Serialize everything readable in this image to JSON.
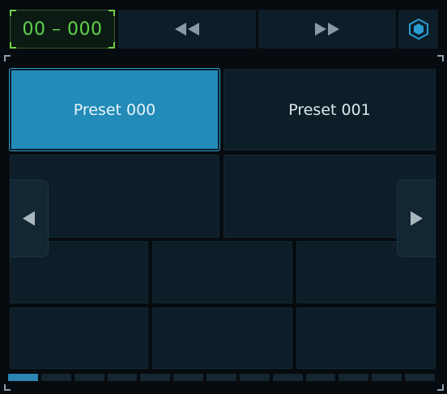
{
  "toolbar": {
    "counter": "00 – 000",
    "rewind_icon": "double-left-triangle",
    "forward_icon": "double-right-triangle",
    "menu_icon": "hexagon-icon"
  },
  "presets": [
    {
      "label": "Preset 000",
      "active": true
    },
    {
      "label": "Preset 001",
      "active": false
    },
    {
      "label": "",
      "active": false
    },
    {
      "label": "",
      "active": false
    },
    {
      "label": "",
      "active": false
    },
    {
      "label": "",
      "active": false
    },
    {
      "label": "",
      "active": false
    },
    {
      "label": "",
      "active": false
    },
    {
      "label": "",
      "active": false
    },
    {
      "label": "",
      "active": false
    }
  ],
  "nav": {
    "prev_icon": "left-triangle",
    "next_icon": "right-triangle"
  },
  "pager": {
    "total_pages": 13,
    "current_page": 1
  },
  "colors": {
    "accent": "#228bb7",
    "counter_text": "#5fd24a",
    "background": "#060b0f",
    "pad": "#0d1e28"
  }
}
